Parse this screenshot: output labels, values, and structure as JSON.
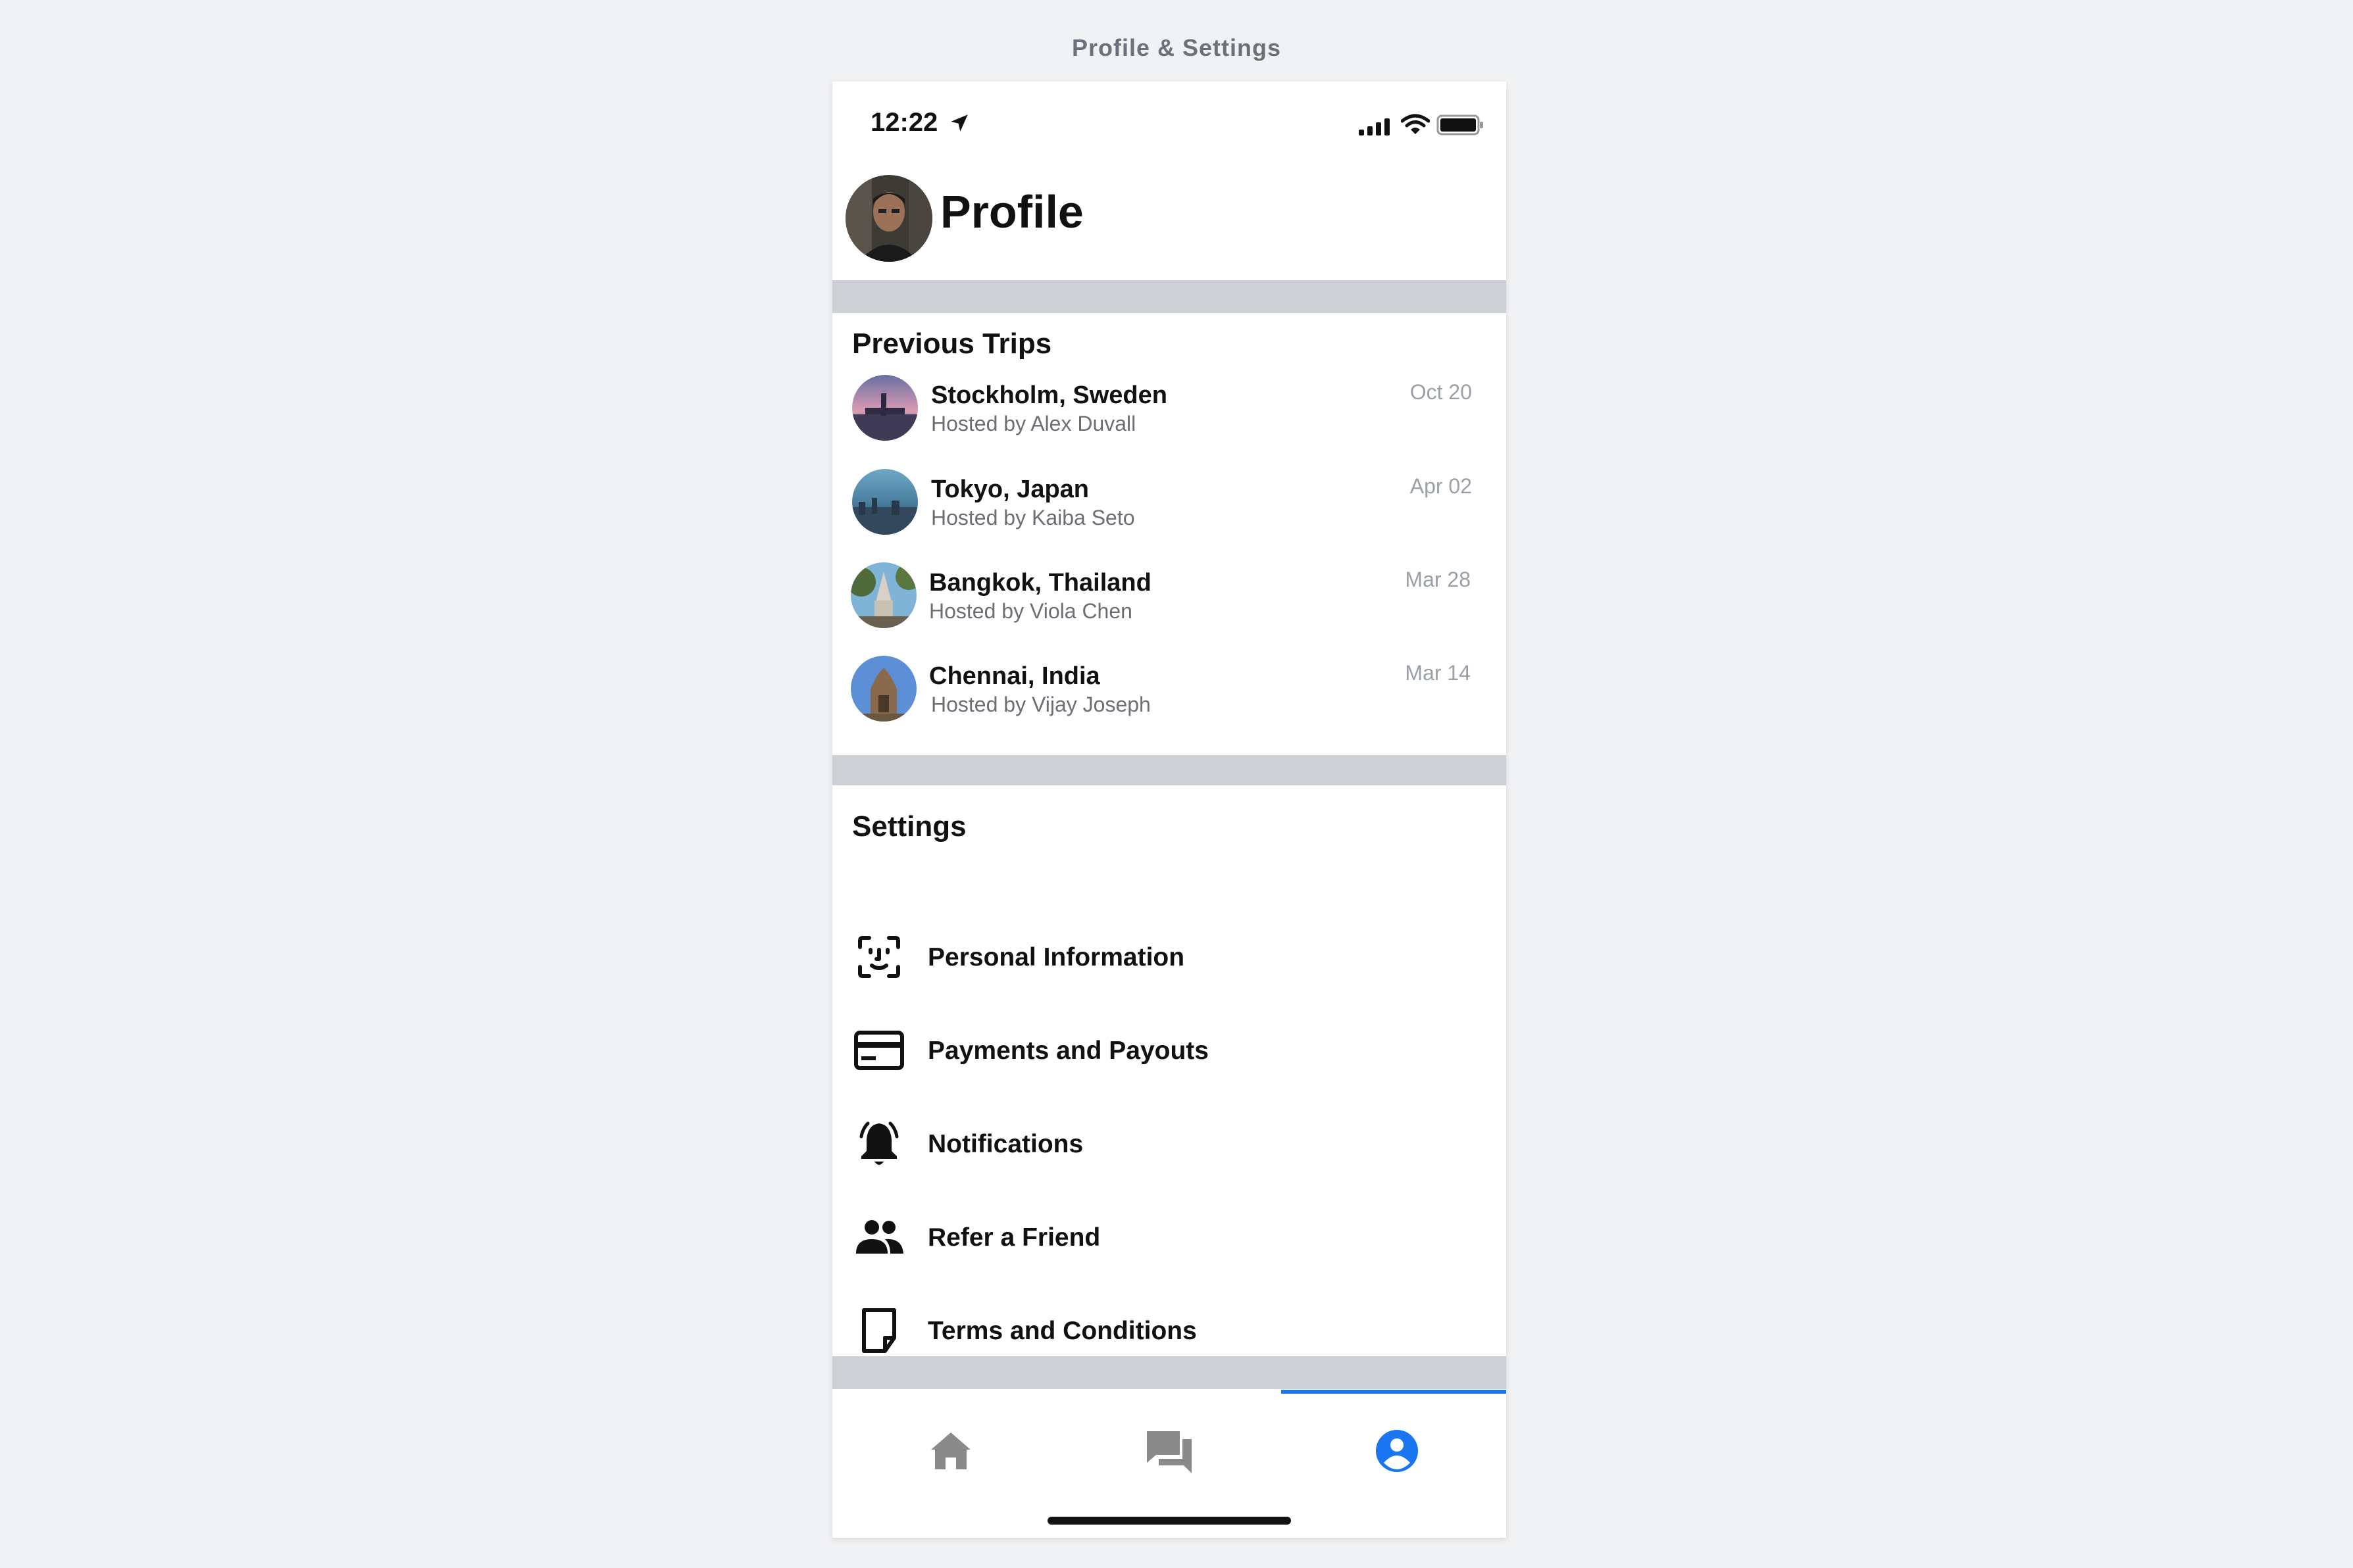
{
  "caption": "Profile & Settings",
  "status_bar": {
    "time": "12:22"
  },
  "header": {
    "title": "Profile"
  },
  "trips": {
    "heading": "Previous Trips",
    "items": [
      {
        "title": "Stockholm, Sweden",
        "host": "Hosted by Alex Duvall",
        "date": "Oct 20"
      },
      {
        "title": "Tokyo, Japan",
        "host": "Hosted by Kaiba Seto",
        "date": "Apr 02"
      },
      {
        "title": "Bangkok, Thailand",
        "host": "Hosted by Viola Chen",
        "date": "Mar 28"
      },
      {
        "title": "Chennai, India",
        "host": "Hosted by Vijay Joseph",
        "date": "Mar 14"
      }
    ]
  },
  "settings": {
    "heading": "Settings",
    "items": [
      {
        "label": "Personal Information",
        "icon": "face-id-icon"
      },
      {
        "label": "Payments and Payouts",
        "icon": "credit-card-icon"
      },
      {
        "label": "Notifications",
        "icon": "bell-icon"
      },
      {
        "label": "Refer a Friend",
        "icon": "people-icon"
      },
      {
        "label": "Terms and Conditions",
        "icon": "document-icon"
      }
    ]
  },
  "tab_bar": {
    "tabs": [
      {
        "icon": "home-icon",
        "active": false
      },
      {
        "icon": "chat-icon",
        "active": false
      },
      {
        "icon": "account-icon",
        "active": true
      }
    ]
  },
  "colors": {
    "accent": "#1976f0",
    "band": "#cdd0d4",
    "muted": "#6b6e75",
    "date": "#9aa0a8",
    "inactive_icon": "#8a8a8a"
  }
}
